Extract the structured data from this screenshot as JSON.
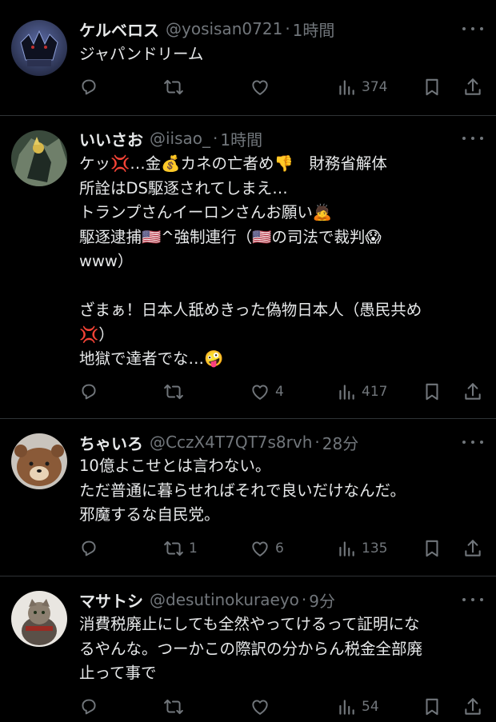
{
  "tweets": [
    {
      "name": "ケルベロス",
      "handle": "@yosisan0721",
      "sep": "·",
      "time": "1時間",
      "body": "ジャパンドリーム",
      "reply_count": "",
      "retweet_count": "",
      "like_count": "",
      "view_count": "374"
    },
    {
      "name": "いいさお",
      "handle": "@iisao_",
      "sep": "·",
      "time": "1時間",
      "body": "ケッ💢…金💰カネの亡者め👎　財務省解体\n所詮はDS駆逐されてしまえ…\nトランプさんイーロンさんお願い🙇\n駆逐逮捕🇺🇸^強制連行（🇺🇸の司法で裁判😱\nwww）\n\nざまぁ！日本人舐めきった偽物日本人（愚民共め\n💢）\n地獄で達者でな…🤪",
      "reply_count": "",
      "retweet_count": "",
      "like_count": "4",
      "view_count": "417"
    },
    {
      "name": "ちゃいろ",
      "handle": "@CczX4T7QT7s8rvh",
      "sep": "·",
      "time": "28分",
      "body": "10億よこせとは言わない。\nただ普通に暮らせればそれで良いだけなんだ。\n邪魔するな自民党。",
      "reply_count": "",
      "retweet_count": "1",
      "like_count": "6",
      "view_count": "135"
    },
    {
      "name": "マサトシ",
      "handle": "@desutinokuraeyo",
      "sep": "·",
      "time": "9分",
      "body": "消費税廃止にしても全然やってけるって証明にな\nるやんな。つーかこの際訳の分からん税金全部廃\n止って事で",
      "reply_count": "",
      "retweet_count": "",
      "like_count": "",
      "view_count": "54"
    }
  ],
  "icons": {
    "reply": "reply-icon",
    "retweet": "retweet-icon",
    "like": "heart-icon",
    "views": "views-icon",
    "bookmark": "bookmark-icon",
    "share": "share-icon",
    "more": "more-icon"
  },
  "colors": {
    "background": "#000000",
    "text": "#e7e9ea",
    "muted": "#71767b",
    "divider": "#2f3336"
  }
}
